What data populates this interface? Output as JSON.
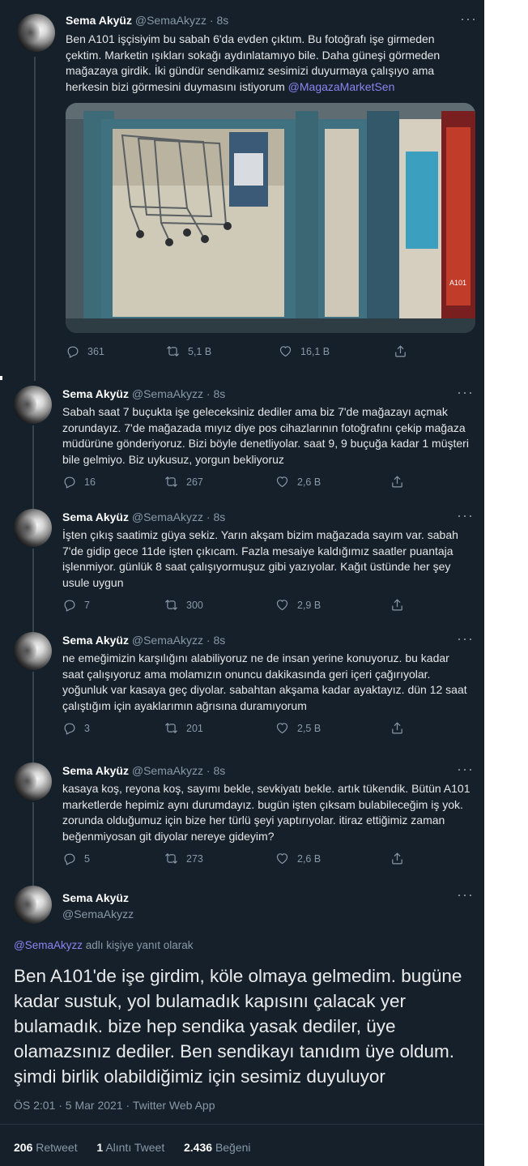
{
  "main_tweet": {
    "name": "Sema Akyüz",
    "handle": "@SemaAkyzz",
    "time": "8s",
    "text": "Ben A101 işçisiyim bu sabah 6'da evden çıktım. Bu fotoğrafı işe girmeden çektim. Marketin ışıkları sokağı aydınlatamıyo bile. Daha güneşi görmeden mağazaya girdik. İki gündür sendikamız sesimizi duyurmaya çalışıyo ama herkesin bizi görmesini duymasını istiyorum",
    "mention": "@MagazaMarketSen",
    "photo_sign": "A101",
    "replies": "361",
    "retweets": "5,1 B",
    "likes": "16,1 B"
  },
  "thread": [
    {
      "name": "Sema Akyüz",
      "handle": "@SemaAkyzz",
      "time": "8s",
      "text": "Sabah saat 7 buçukta işe geleceksiniz dediler ama biz 7'de mağazayı açmak zorundayız. 7'de mağazada mıyız diye pos cihazlarının fotoğrafını çekip mağaza müdürüne gönderiyoruz. Bizi böyle denetliyolar. saat 9, 9 buçuğa kadar 1 müşteri bile gelmiyo. Biz uykusuz, yorgun bekliyoruz",
      "replies": "16",
      "retweets": "267",
      "likes": "2,6 B"
    },
    {
      "name": "Sema Akyüz",
      "handle": "@SemaAkyzz",
      "time": "8s",
      "text": "İşten çıkış saatimiz güya sekiz. Yarın akşam bizim mağazada sayım var. sabah 7'de gidip gece 11de işten çıkıcam. Fazla mesaiye kaldığımız saatler puantaja işlenmiyor. günlük 8 saat çalışıyormuşuz gibi yazıyolar. Kağıt üstünde her şey usule uygun",
      "replies": "7",
      "retweets": "300",
      "likes": "2,9 B"
    },
    {
      "name": "Sema Akyüz",
      "handle": "@SemaAkyzz",
      "time": "8s",
      "text": "ne emeğimizin karşılığını alabiliyoruz ne de insan yerine konuyoruz. bu kadar saat çalışıyoruz ama molamızın onuncu dakikasında geri içeri çağırıyolar. yoğunluk var kasaya geç diyolar. sabahtan akşama kadar ayaktayız. dün 12 saat çalıştığım için ayaklarımın ağrısına duramıyorum",
      "replies": "3",
      "retweets": "201",
      "likes": "2,5 B"
    },
    {
      "name": "Sema Akyüz",
      "handle": "@SemaAkyzz",
      "time": "8s",
      "text": "kasaya koş, reyona koş, sayımı bekle, sevkiyatı bekle. artık tükendik. Bütün A101 marketlerde hepimiz aynı durumdayız. bugün işten çıksam bulabileceğim iş yok. zorunda olduğumuz için bize her türlü şeyi yaptırıyolar. itiraz ettiğimiz zaman beğenmiyosan git diyolar nereye gideyim?",
      "replies": "5",
      "retweets": "273",
      "likes": "2,6 B"
    }
  ],
  "focused": {
    "name": "Sema Akyüz",
    "handle": "@SemaAkyzz",
    "reply_mention": "@SemaAkyzz",
    "reply_suffix": " adlı kişiye yanıt olarak",
    "text": "Ben A101'de işe girdim, köle olmaya gelmedim. bugüne kadar sustuk, yol bulamadık kapısını çalacak yer bulamadık. bize hep sendika yasak dediler, üye olamazsınız dediler. Ben sendikayı tanıdım üye oldum. şimdi birlik olabildiğimiz için sesimiz duyuluyor",
    "meta": "ÖS 2:01 · 5 Mar 2021 · Twitter Web App",
    "stats": {
      "retweet_count": "206",
      "retweet_label": "Retweet",
      "quote_count": "1",
      "quote_label": "Alıntı Tweet",
      "like_count": "2.436",
      "like_label": "Beğeni"
    }
  },
  "ui": {
    "more_glyph": "···"
  },
  "colors": {
    "background": "#15202b",
    "accent": "#8b84f2",
    "muted": "#8899a6",
    "text": "#e6e6e6"
  },
  "icons": [
    "reply-icon",
    "retweet-icon",
    "like-icon",
    "share-icon",
    "more-icon"
  ]
}
